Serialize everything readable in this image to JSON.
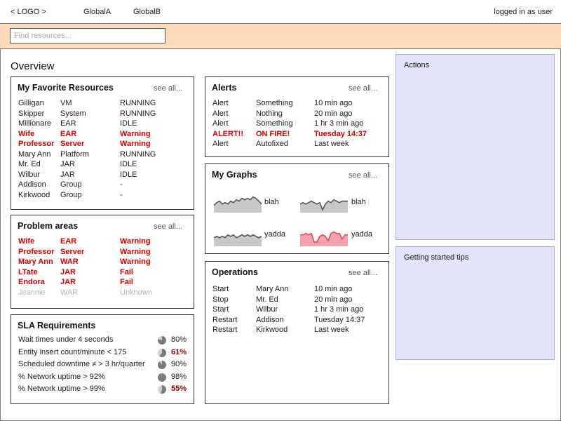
{
  "header": {
    "logo": "< LOGO >",
    "nav": [
      "GlobalA",
      "GlobalB"
    ],
    "user_status": "logged in as user"
  },
  "search": {
    "placeholder": "Find resources..."
  },
  "page_title": "Overview",
  "see_all": "see all...",
  "favorites": {
    "title": "My Favorite Resources",
    "rows": [
      {
        "name": "Gilligan",
        "type": "VM",
        "status": "RUNNING",
        "state": "normal"
      },
      {
        "name": "Skipper",
        "type": "System",
        "status": "RUNNING",
        "state": "normal"
      },
      {
        "name": "Millionare",
        "type": "EAR",
        "status": "IDLE",
        "state": "normal"
      },
      {
        "name": "Wife",
        "type": "EAR",
        "status": "Warning",
        "state": "alert"
      },
      {
        "name": "Professor",
        "type": "Server",
        "status": "Warning",
        "state": "alert"
      },
      {
        "name": "Mary Ann",
        "type": "Platform",
        "status": "RUNNING",
        "state": "normal"
      },
      {
        "name": "Mr. Ed",
        "type": "JAR",
        "status": "IDLE",
        "state": "normal"
      },
      {
        "name": "Wilbur",
        "type": "JAR",
        "status": "IDLE",
        "state": "normal"
      },
      {
        "name": "Addison",
        "type": "Group",
        "status": "-",
        "state": "normal"
      },
      {
        "name": "Kirkwood",
        "type": "Group",
        "status": "-",
        "state": "normal"
      }
    ]
  },
  "problems": {
    "title": "Problem areas",
    "rows": [
      {
        "name": "Wife",
        "type": "EAR",
        "status": "Warning",
        "state": "alert"
      },
      {
        "name": "Professor",
        "type": "Server",
        "status": "Warning",
        "state": "alert"
      },
      {
        "name": "Mary Ann",
        "type": "WAR",
        "status": "Warning",
        "state": "alert"
      },
      {
        "name": "LTate",
        "type": "JAR",
        "status": "Fail",
        "state": "alert"
      },
      {
        "name": "Endora",
        "type": "JAR",
        "status": "Fail",
        "state": "alert"
      },
      {
        "name": "Jeannie",
        "type": "WAR",
        "status": "Unknown",
        "state": "muted"
      }
    ]
  },
  "sla": {
    "title": "SLA Requirements",
    "rows": [
      {
        "label": "Wait times under 4 seconds",
        "value": "80%",
        "fraction": 0.8,
        "bad": false
      },
      {
        "label": "Entity insert count/minute < 175",
        "value": "61%",
        "fraction": 0.61,
        "bad": true
      },
      {
        "label": "Scheduled downtime ≠ > 3 hr/quarter",
        "value": "90%",
        "fraction": 0.9,
        "bad": false
      },
      {
        "label": "% Network uptime > 92%",
        "value": "98%",
        "fraction": 0.98,
        "bad": false
      },
      {
        "label": "% Network uptime > 99%",
        "value": "55%",
        "fraction": 0.55,
        "bad": true
      }
    ]
  },
  "alerts": {
    "title": "Alerts",
    "rows": [
      {
        "kind": "Alert",
        "message": "Something",
        "time": "10 min ago",
        "state": "normal"
      },
      {
        "kind": "Alert",
        "message": "Nothing",
        "time": "20 min ago",
        "state": "normal"
      },
      {
        "kind": "Alert",
        "message": "Something",
        "time": "1 hr 3 min ago",
        "state": "normal"
      },
      {
        "kind": "ALERT!!",
        "message": "ON FIRE!",
        "time": "Tuesday 14:37",
        "state": "alert"
      },
      {
        "kind": "Alert",
        "message": "Autofixed",
        "time": "Last week",
        "state": "normal"
      }
    ]
  },
  "graphs": {
    "title": "My Graphs",
    "items": [
      {
        "label": "blah",
        "highlight": false,
        "values": [
          4,
          6,
          7,
          5,
          6,
          5,
          7,
          6,
          8,
          7,
          9,
          8,
          9,
          8,
          10,
          9,
          7,
          5
        ]
      },
      {
        "label": "blah",
        "highlight": false,
        "values": [
          5,
          6,
          5,
          6,
          7,
          6,
          5,
          6,
          1,
          5,
          7,
          6,
          8,
          7,
          6,
          7,
          7,
          7
        ]
      },
      {
        "label": "yadda",
        "highlight": false,
        "values": [
          5,
          6,
          5,
          6,
          5,
          7,
          6,
          7,
          5,
          6,
          7,
          6,
          7,
          6,
          7,
          6,
          5,
          6
        ]
      },
      {
        "label": "yadda",
        "highlight": true,
        "values": [
          7,
          7,
          8,
          7,
          8,
          2,
          2,
          6,
          7,
          6,
          3,
          8,
          9,
          8,
          8,
          4,
          7,
          7
        ]
      }
    ],
    "colors": {
      "normal_fill": "#c8c8c8",
      "normal_line": "#555555",
      "highlight_fill": "#f4a3ad",
      "highlight_line": "#e0465f"
    }
  },
  "operations": {
    "title": "Operations",
    "rows": [
      {
        "action": "Start",
        "target": "Mary Ann",
        "time": "10 min ago"
      },
      {
        "action": "Stop",
        "target": "Mr. Ed",
        "time": "20 min ago"
      },
      {
        "action": "Start",
        "target": "Wilbur",
        "time": "1 hr 3 min ago"
      },
      {
        "action": "Restart",
        "target": "Addison",
        "time": "Tuesday 14:37"
      },
      {
        "action": "Restart",
        "target": "Kirkwood",
        "time": "Last week"
      }
    ]
  },
  "actions": {
    "title": "Actions"
  },
  "tips": {
    "title": "Getting started tips"
  }
}
